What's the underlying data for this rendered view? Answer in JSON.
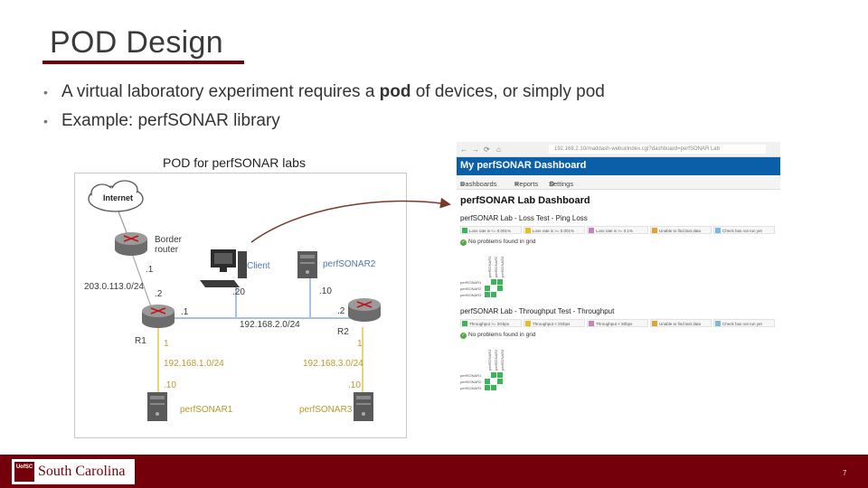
{
  "slide": {
    "title": "POD Design",
    "bullets": [
      {
        "before": "A virtual laboratory experiment requires a ",
        "bold": "pod",
        "after": " of devices, or simply pod"
      },
      {
        "before": "Example: perf",
        "bold": "",
        "after": "SONAR library"
      }
    ],
    "page_number": "7",
    "colors": {
      "accent": "#73000a",
      "footer": "#73000a",
      "dashboard_header": "#0a5fa8"
    }
  },
  "pod_diagram": {
    "caption": "POD for perfSONAR labs",
    "internet_label": "Internet",
    "border_router_label": "Border\nrouter",
    "public_subnet": "203.0.113.0/24",
    "labels": {
      "br_iface": ".1",
      "r1_up_iface": ".2",
      "r1_left_iface": ".1",
      "r1_label": "R1",
      "r2_label": "R2",
      "r2_iface": ".2",
      "client_label": "Client",
      "client_iface": ".20",
      "ps2_label": "perfSONAR2",
      "ps2_iface": ".10",
      "center_subnet": "192.168.2.0/24",
      "left_iface_top": "1",
      "left_subnet": "192.168.1.0/24",
      "left_iface_bottom": ".10",
      "ps1_label": "perfSONAR1",
      "right_iface_top": "1",
      "right_subnet": "192.168.3.0/24",
      "right_iface_bottom": ".10",
      "ps3_label": "perfSONAR3"
    },
    "icons": [
      "cloud-icon",
      "router-icon",
      "workstation-icon",
      "server-icon"
    ]
  },
  "dashboard": {
    "url": "192.168.2.10/maddash-webui/index.cgi?dashboard=perfSONAR Lab",
    "app_title": "My perfSONAR Dashboard",
    "nav": [
      "Dashboards",
      "Reports",
      "Settings"
    ],
    "lab_title": "perfSONAR Lab Dashboard",
    "loss_section": {
      "title": "perfSONAR Lab - Loss Test - Ping Loss",
      "legend": [
        {
          "label": "Loss rate is <= 0.001%",
          "color": "#3bb55a"
        },
        {
          "label": "Loss rate is >= 0.001%",
          "color": "#e5c020"
        },
        {
          "label": "Loss rate is >= 0.1%",
          "color": "#c880c0"
        },
        {
          "label": "Unable to find last data",
          "color": "#e8a030"
        },
        {
          "label": "Check has not run yet",
          "color": "#7ab8e0"
        }
      ],
      "status": "No problems found in grid",
      "rows": [
        "perfSONAR1",
        "perfSONAR2",
        "perfSONAR3"
      ],
      "cols": [
        "perfSONAR1",
        "perfSONAR2",
        "perfSONAR3"
      ]
    },
    "throughput_section": {
      "title": "perfSONAR Lab - Throughput Test - Throughput",
      "legend": [
        {
          "label": "Throughput >= 2Gbps",
          "color": "#3bb55a"
        },
        {
          "label": "Throughput < 2Gbps",
          "color": "#e5c020"
        },
        {
          "label": "Throughput < 50bps",
          "color": "#c880c0"
        },
        {
          "label": "Unable to find last data",
          "color": "#e8a030"
        },
        {
          "label": "Check has not run yet",
          "color": "#7ab8e0"
        }
      ],
      "status": "No problems found in grid",
      "rows": [
        "perfSONAR1",
        "perfSONAR2",
        "perfSONAR3"
      ],
      "cols": [
        "perfSONAR1",
        "perfSONAR2",
        "perfSONAR3"
      ]
    }
  },
  "footer": {
    "logo_mark": "UofSC",
    "logo_text": "South Carolina"
  }
}
